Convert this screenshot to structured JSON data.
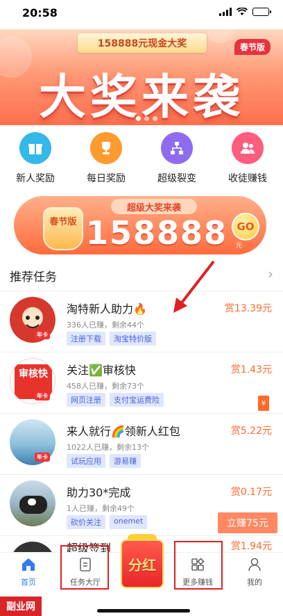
{
  "status_bar": {
    "time": "20:58"
  },
  "banner": {
    "ribbon": "158888元现金大奖",
    "tag": "春节版",
    "title": "大奖来袭"
  },
  "quick_actions": [
    {
      "label": "新人奖励",
      "icon": "gift-icon",
      "color": "#33b8e8"
    },
    {
      "label": "每日奖励",
      "icon": "trophy-icon",
      "color": "#ff9a2e"
    },
    {
      "label": "超级裂变",
      "icon": "network-icon",
      "color": "#8f6bf0"
    },
    {
      "label": "收徒赚钱",
      "icon": "users-icon",
      "color": "#ff5d7d"
    }
  ],
  "promo": {
    "header": "超级大奖来袭",
    "jar_text": "春节版",
    "amount": "158888",
    "unit": "元",
    "go": "GO"
  },
  "section": {
    "title": "推荐任务",
    "more": "›"
  },
  "tasks": [
    {
      "title": "淘特新人助力🔥",
      "meta": "336人已赚，剩余44个",
      "tags": [
        "注册下载",
        "淘宝特价版"
      ],
      "reward": "赏13.39元"
    },
    {
      "title": "关注✅审核快",
      "meta": "458人已赚，剩余73个",
      "tags": [
        "网页注册",
        "支付宝运费险"
      ],
      "reward": "赏1.43元",
      "avatar_text": "审核快"
    },
    {
      "title": "来人就行🌈领新人红包",
      "meta": "1022人已赚，剩余13个",
      "tags": [
        "试玩应用",
        "游易赚"
      ],
      "reward": "赏5.22元"
    },
    {
      "title": "助力30*完成",
      "meta": "1人已赚，剩余49个",
      "tags": [
        "砍价关注",
        "onemet"
      ],
      "reward": "赏0.17元",
      "button": "立赚75元"
    }
  ],
  "partial_task": {
    "title": "超级签到",
    "reward": "赏1.94元"
  },
  "tabbar": {
    "items": [
      {
        "label": "首页",
        "icon": "home-icon"
      },
      {
        "label": "任务大厅",
        "icon": "task-list-icon"
      },
      {
        "label": "分红",
        "icon": "red-envelope-icon"
      },
      {
        "label": "更多赚钱",
        "icon": "apps-icon"
      },
      {
        "label": "我的",
        "icon": "user-icon"
      }
    ]
  },
  "watermark": "副业网",
  "colors": {
    "accent": "#ff6a2b",
    "tab_active": "#2f7bf5",
    "tag_bg": "#dfe6ff",
    "highlight": "#e02020"
  }
}
